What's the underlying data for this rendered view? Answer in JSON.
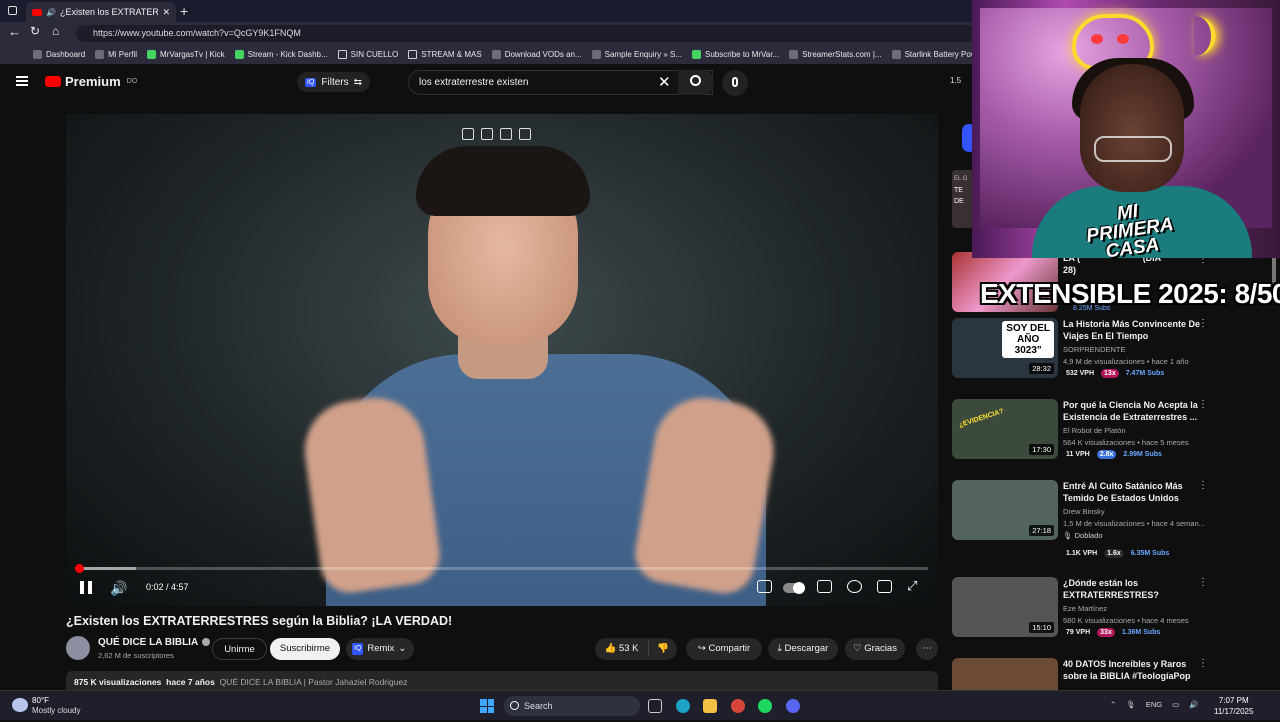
{
  "browser": {
    "tab_title": "¿Existen los EXTRATERRESTRES",
    "new_tab": "+",
    "url": "https://www.youtube.com/watch?v=QcGY9K1FNQM",
    "bookmarks": [
      {
        "label": "Dashboard",
        "icon": "bookmark-icon"
      },
      {
        "label": "Mi Perfil",
        "icon": "bookmark-icon"
      },
      {
        "label": "MrVargasTv | Kick",
        "icon": "kick-icon"
      },
      {
        "label": "Stream - Kick Dashb...",
        "icon": "kick-icon"
      },
      {
        "label": "SIN CUELLO",
        "icon": "folder-icon"
      },
      {
        "label": "STREAM & MAS",
        "icon": "folder-icon"
      },
      {
        "label": "Download VODs an...",
        "icon": "bookmark-icon"
      },
      {
        "label": "Sample Enquiry » S...",
        "icon": "globe-icon"
      },
      {
        "label": "Subscribe to MrVar...",
        "icon": "kick-icon"
      },
      {
        "label": "StreamerStats.com |...",
        "icon": "bookmark-icon"
      },
      {
        "label": "Starlink Battery Pow...",
        "icon": "bookmark-icon"
      }
    ]
  },
  "masthead": {
    "logo": "Premium",
    "logo_badge": "DO",
    "filters_badge": "IQ",
    "filters_label": "Filters",
    "search_value": "los extraterrestre existen",
    "clear": "✕",
    "right_clip": "1.5"
  },
  "player": {
    "timecode": "0:02 / 4:57",
    "progress_fraction": 0.007,
    "buffer_fraction": 0.07
  },
  "video": {
    "title": "¿Existen los EXTRATERRESTRES según la Biblia? ¡LA VERDAD!",
    "channel": "QUÉ DICE LA BIBLIA",
    "subscribers": "2,62 M de suscriptores",
    "join": "Unirme",
    "subscribe": "Suscribirme",
    "remix_badge": "IQ",
    "remix": "Remix",
    "likes": "53 K",
    "share": "Compartir",
    "download": "Descargar",
    "thanks": "Gracias",
    "views": "875 K visualizaciones",
    "age": "hace 7 años",
    "description": "QUÉ DICE LA BIBLIA | Pastor Jahaziel Rodriguez"
  },
  "sidebar": {
    "partial_title_line1": "LA (",
    "partial_title_line1_end": "(DIA",
    "partial_title_line2": "28)",
    "partial_thumb_text": "TE DE",
    "partial_thumb_label": "EL G",
    "partial_subs": "8.25M Subs",
    "items": [
      {
        "title": "La Historia Más Convincente De Viajes En El Tiempo",
        "channel": "SORPRENDENTE",
        "views": "4,9 M de visualizaciones • hace 1 año",
        "duration": "28:32",
        "vph": "532 VPH",
        "mult": "13x",
        "subs": "7.47M Subs",
        "thumb_color": "#2a3540",
        "mult_color": "#b3165a"
      },
      {
        "title": "Por qué la Ciencia No Acepta la Existencia de Extraterrestres ...",
        "channel": "El Robot de Platón",
        "views": "564 K visualizaciones • hace 5 meses",
        "duration": "17:30",
        "vph": "11 VPH",
        "mult": "2.8x",
        "subs": "2.99M Subs",
        "thumb_color": "#3b4a3a",
        "mult_color": "#3d6fd8"
      },
      {
        "title": "Entré Al Culto Satánico Más Temido De Estados Unidos",
        "channel": "Drew Binsky",
        "views": "1,5 M de visualizaciones • hace 4 seman...",
        "duration": "27:18",
        "dubbed": "Doblado",
        "vph": "1.1K VPH",
        "mult": "1.6x",
        "subs": "6.35M Subs",
        "thumb_color": "#53645e",
        "mult_color": "#272727"
      },
      {
        "title": "¿Dónde están los EXTRATERRESTRES?",
        "channel": "Eze Martínez",
        "views": "580 K visualizaciones • hace 4 meses",
        "duration": "15:10",
        "vph": "79 VPH",
        "mult": "33x",
        "subs": "1.36M Subs",
        "thumb_color": "#555",
        "mult_color": "#b3165a"
      },
      {
        "title": "40 DATOS Increíbles y Raros sobre la BIBLIA #TeologíaPop",
        "channel": "",
        "views": "",
        "duration": "",
        "vph": "",
        "mult": "",
        "subs": "",
        "thumb_color": "#6b4b35",
        "mult_color": "#272727"
      }
    ]
  },
  "thumb_text": {
    "soy_del": "SOY DEL",
    "ano": "AÑO",
    "year": "3023\"",
    "evidencia": "¿EVIDENCIA?"
  },
  "stream_overlay": {
    "sign": "MI PRIMERA CASA",
    "goal": "EXTENSIBLE 2025: 8/50"
  },
  "taskbar": {
    "temp": "80°F",
    "weather": "Mostly cloudy",
    "search": "Search",
    "lang": "ENG",
    "time": "7:07 PM",
    "date": "11/17/2025"
  },
  "colors": {
    "youtube_red": "#ff0000",
    "accent_blue": "#3355ff"
  }
}
